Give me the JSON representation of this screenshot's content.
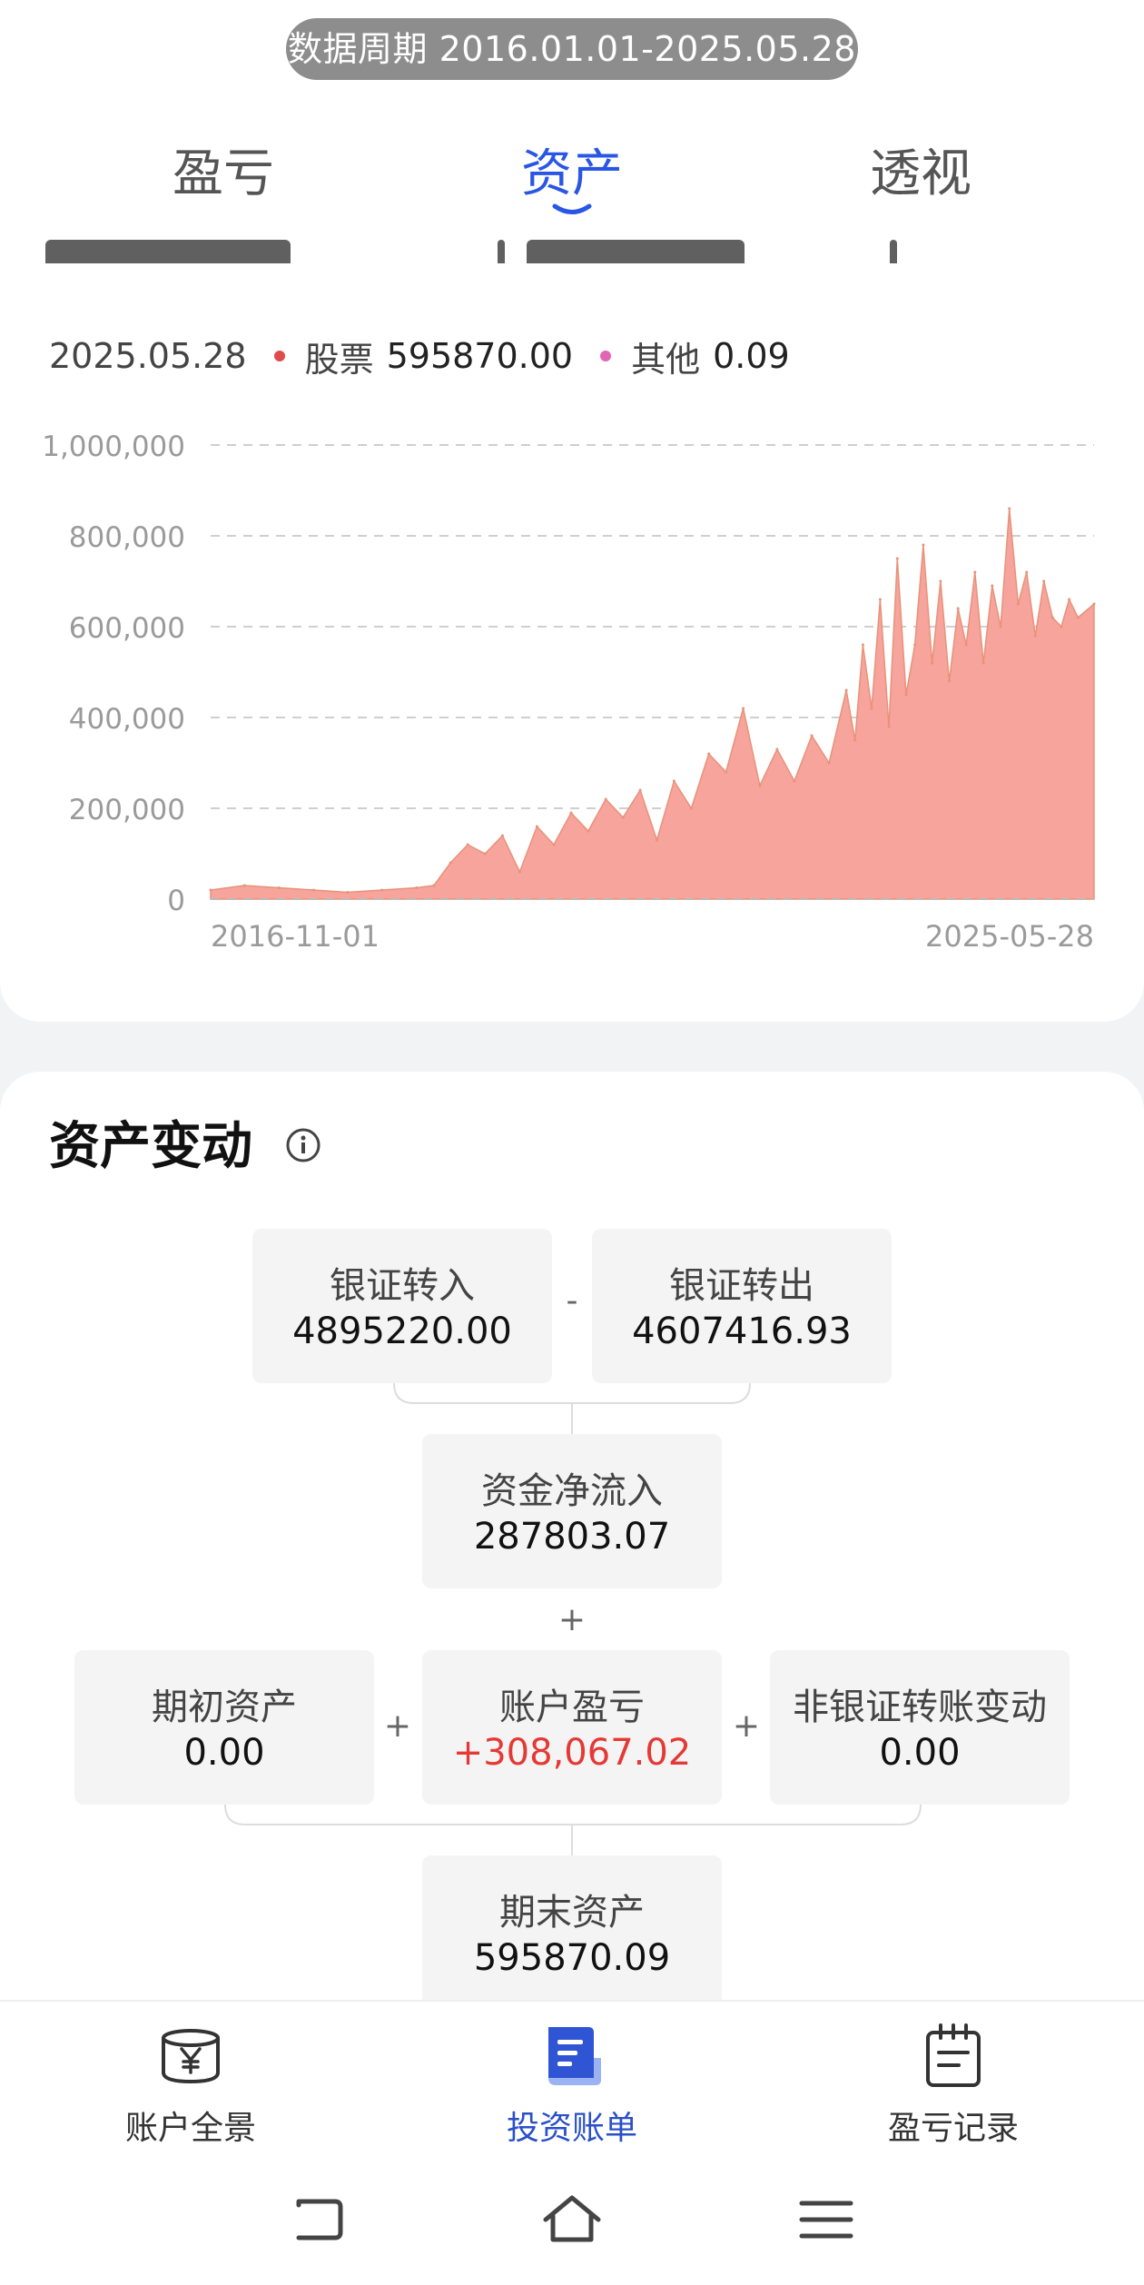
{
  "header": {
    "period_label": "数据周期 2016.01.01-2025.05.28"
  },
  "tabs": [
    {
      "label": "盈亏",
      "active": false
    },
    {
      "label": "资产",
      "active": true
    },
    {
      "label": "透视",
      "active": false
    }
  ],
  "legend": {
    "date": "2025.05.28",
    "items": [
      {
        "name": "股票",
        "value": "595870.00",
        "color": "#e04b4b"
      },
      {
        "name": "其他",
        "value": "0.09",
        "color": "#e066b4"
      }
    ]
  },
  "chart_data": {
    "type": "area",
    "y_ticks": [
      "1,000,000",
      "800,000",
      "600,000",
      "400,000",
      "200,000",
      "0"
    ],
    "ylim": [
      0,
      1000000
    ],
    "x_labels": [
      "2016-11-01",
      "2025-05-28"
    ],
    "grid": true,
    "series": [
      {
        "name": "股票",
        "color": "#f6a49c",
        "x": [
          "2016-11-01",
          "2017-03-01",
          "2017-07-01",
          "2017-11-01",
          "2018-03-01",
          "2018-07-01",
          "2018-11-01",
          "2019-01-01",
          "2019-03-01",
          "2019-05-01",
          "2019-07-01",
          "2019-09-01",
          "2019-11-01",
          "2020-01-01",
          "2020-03-01",
          "2020-05-01",
          "2020-07-01",
          "2020-09-01",
          "2020-11-01",
          "2021-01-01",
          "2021-03-01",
          "2021-05-01",
          "2021-07-01",
          "2021-09-01",
          "2021-11-01",
          "2022-01-01",
          "2022-03-01",
          "2022-05-01",
          "2022-07-01",
          "2022-09-01",
          "2022-11-01",
          "2023-01-01",
          "2023-02-01",
          "2023-03-01",
          "2023-04-01",
          "2023-05-01",
          "2023-06-01",
          "2023-07-01",
          "2023-08-01",
          "2023-09-01",
          "2023-10-01",
          "2023-11-01",
          "2023-12-01",
          "2024-01-01",
          "2024-02-01",
          "2024-03-01",
          "2024-04-01",
          "2024-05-01",
          "2024-06-01",
          "2024-07-01",
          "2024-08-01",
          "2024-09-01",
          "2024-10-01",
          "2024-11-01",
          "2024-12-01",
          "2025-01-01",
          "2025-02-01",
          "2025-03-01",
          "2025-04-01",
          "2025-05-28"
        ],
        "values": [
          20000,
          30000,
          25000,
          20000,
          15000,
          20000,
          25000,
          30000,
          80000,
          120000,
          100000,
          140000,
          60000,
          160000,
          120000,
          190000,
          150000,
          220000,
          180000,
          240000,
          130000,
          260000,
          200000,
          320000,
          280000,
          420000,
          250000,
          330000,
          260000,
          360000,
          300000,
          460000,
          350000,
          560000,
          420000,
          660000,
          380000,
          750000,
          450000,
          560000,
          780000,
          520000,
          700000,
          480000,
          640000,
          560000,
          720000,
          520000,
          690000,
          600000,
          860000,
          650000,
          720000,
          580000,
          700000,
          620000,
          600000,
          660000,
          620000,
          650000
        ]
      }
    ]
  },
  "asset_change": {
    "title": "资产变动",
    "bank_in": {
      "label": "银证转入",
      "value": "4895220.00"
    },
    "bank_out": {
      "label": "银证转出",
      "value": "4607416.93"
    },
    "minus": "-",
    "net_inflow": {
      "label": "资金净流入",
      "value": "287803.07"
    },
    "plus": "+",
    "initial": {
      "label": "期初资产",
      "value": "0.00"
    },
    "pnl": {
      "label": "账户盈亏",
      "value": "+308,067.02"
    },
    "non_bank": {
      "label": "非银证转账变动",
      "value": "0.00"
    },
    "final": {
      "label": "期末资产",
      "value": "595870.09"
    }
  },
  "bottom_nav": [
    {
      "label": "账户全景",
      "icon": "wallet-yen-icon"
    },
    {
      "label": "投资账单",
      "icon": "bill-icon",
      "active": true
    },
    {
      "label": "盈亏记录",
      "icon": "calendar-note-icon"
    }
  ],
  "colors": {
    "accent": "#2a56e6",
    "profit_red": "#e53935",
    "area_fill": "#f6a49c",
    "area_stroke": "#e8927a"
  }
}
